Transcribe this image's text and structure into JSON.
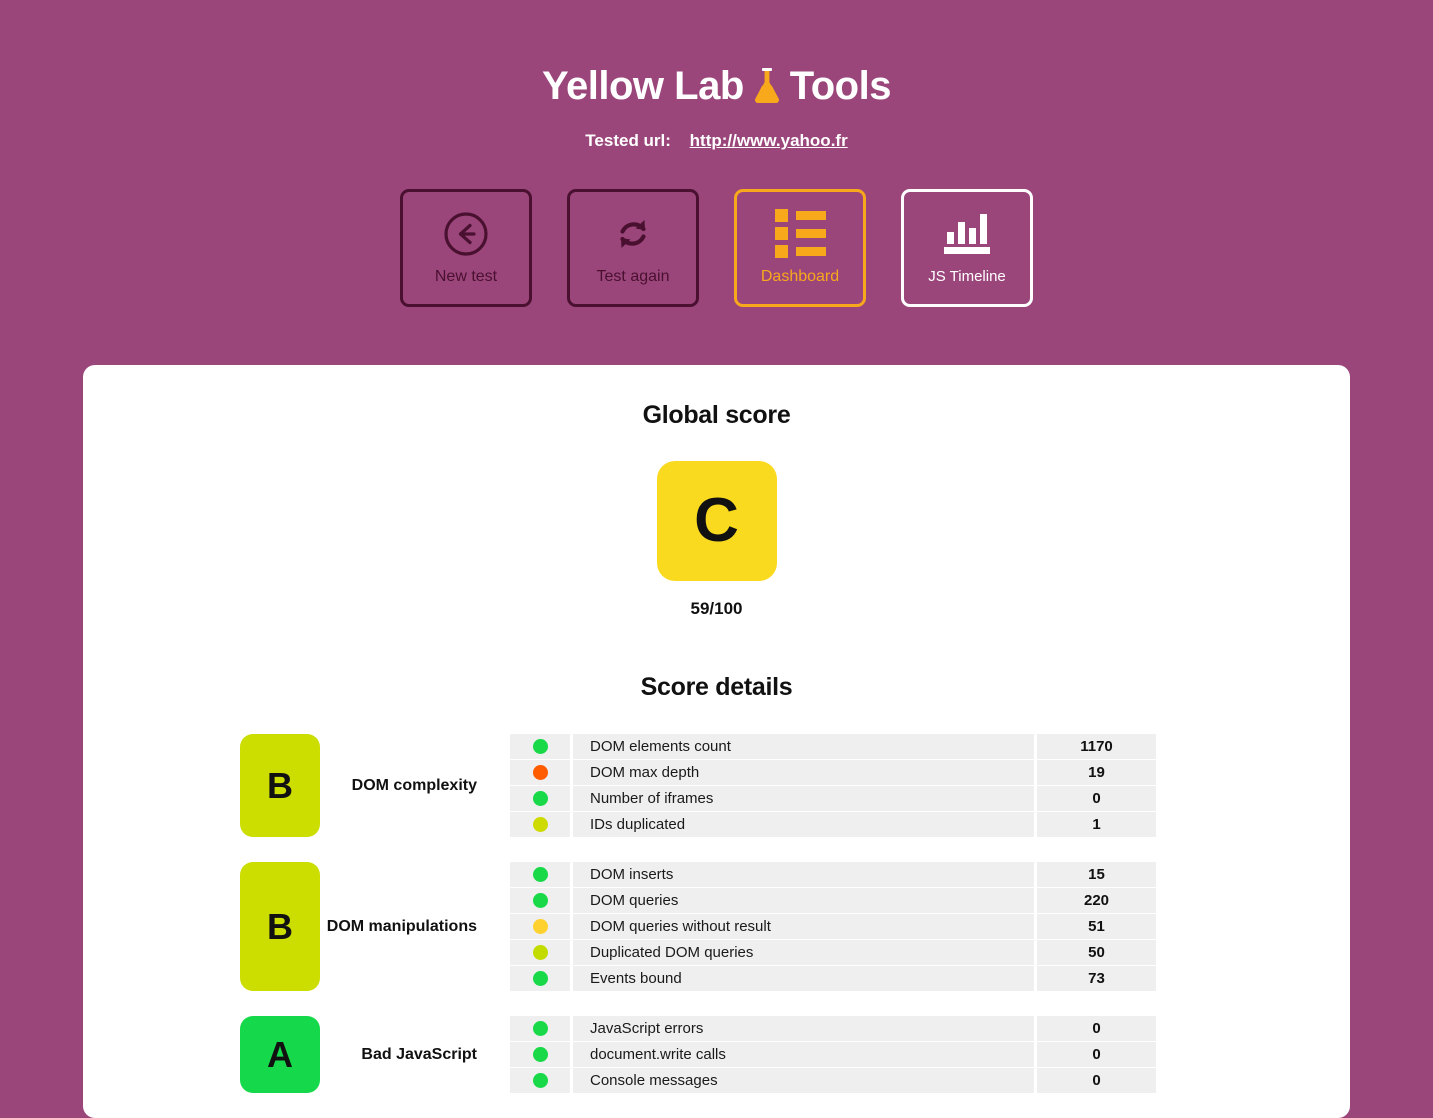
{
  "theme": {
    "background": "#9b467b",
    "accent": "#f7a81b",
    "dark": "#4a1030",
    "card_bg": "#ffffff",
    "row_bg": "#efefef"
  },
  "header": {
    "title_before": "Yellow Lab",
    "title_after": "Tools",
    "flask_icon": "flask-icon",
    "tested_url_label": "Tested url:",
    "tested_url": "http://www.yahoo.fr"
  },
  "nav": {
    "buttons": [
      {
        "label": "New test",
        "icon": "arrow-left-circle-icon",
        "style": "dark"
      },
      {
        "label": "Test again",
        "icon": "refresh-icon",
        "style": "dark"
      },
      {
        "label": "Dashboard",
        "icon": "list-icon",
        "style": "accent"
      },
      {
        "label": "JS Timeline",
        "icon": "bar-chart-icon",
        "style": "light"
      }
    ]
  },
  "global_score": {
    "heading": "Global score",
    "letter": "C",
    "color": "#fada1e",
    "value": "59/100"
  },
  "score_details": {
    "heading": "Score details",
    "groups": [
      {
        "grade": "B",
        "grade_color": "#ccdd00",
        "label": "DOM complexity",
        "rows": [
          {
            "status": "#19d949",
            "label": "DOM elements count",
            "value": "1170"
          },
          {
            "status": "#ff5b00",
            "label": "DOM max depth",
            "value": "19"
          },
          {
            "status": "#19d949",
            "label": "Number of iframes",
            "value": "0"
          },
          {
            "status": "#cddb00",
            "label": "IDs duplicated",
            "value": "1"
          }
        ]
      },
      {
        "grade": "B",
        "grade_color": "#ccdd00",
        "label": "DOM manipulations",
        "rows": [
          {
            "status": "#19d949",
            "label": "DOM inserts",
            "value": "15"
          },
          {
            "status": "#19d949",
            "label": "DOM queries",
            "value": "220"
          },
          {
            "status": "#ffd12e",
            "label": "DOM queries without result",
            "value": "51"
          },
          {
            "status": "#c2dc00",
            "label": "Duplicated DOM queries",
            "value": "50"
          },
          {
            "status": "#19d949",
            "label": "Events bound",
            "value": "73"
          }
        ]
      },
      {
        "grade": "A",
        "grade_color": "#15d94a",
        "label": "Bad JavaScript",
        "rows": [
          {
            "status": "#19d949",
            "label": "JavaScript errors",
            "value": "0"
          },
          {
            "status": "#19d949",
            "label": "document.write calls",
            "value": "0"
          },
          {
            "status": "#19d949",
            "label": "Console messages",
            "value": "0"
          }
        ]
      }
    ]
  }
}
